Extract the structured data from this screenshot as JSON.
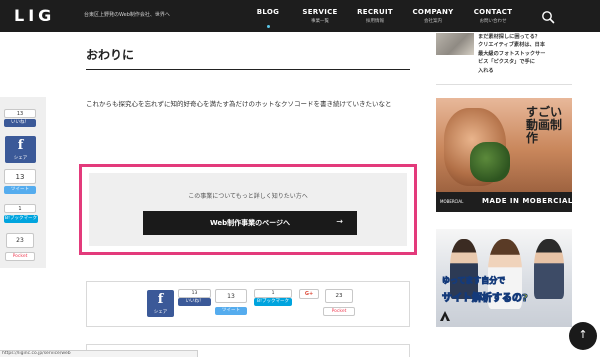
{
  "header": {
    "logo": "LIG",
    "tagline": "台東区上野発のWeb制作会社、世界へ",
    "nav": [
      {
        "en": "BLOG",
        "ja": "",
        "active": true
      },
      {
        "en": "SERVICE",
        "ja": "事業一覧",
        "active": false
      },
      {
        "en": "RECRUIT",
        "ja": "採用情報",
        "active": false
      },
      {
        "en": "COMPANY",
        "ja": "会社案内",
        "active": false
      },
      {
        "en": "CONTACT",
        "ja": "お問い合わせ",
        "active": false
      }
    ],
    "search_icon": "search-icon"
  },
  "article": {
    "section_title": "おわりに",
    "body": "これからも探究心を忘れずに知的好奇心を満たす為だけのホットなクソコードを書き続けていきたいなと"
  },
  "cta": {
    "lead": "この事業についてもっと詳しく知りたい方へ",
    "button_label": "Web制作事業のページへ",
    "arrow": "→"
  },
  "share": {
    "facebook_label": "シェア",
    "like_count": "13",
    "like_label": "いいね！",
    "tweet_count": "13",
    "tweet_label": "ツイート",
    "hatena_count": "1",
    "hatena_label": "B!ブックマーク",
    "gplus_label": "G+",
    "pocket_count": "23",
    "pocket_label": "Pocket"
  },
  "sidebar": {
    "article_lines": [
      "まだ素材探しに困ってる？",
      "クリエイティブ素材は、日本",
      "最大級のフォトストックサー",
      "ビス「ピクスタ」で手に",
      "入れる"
    ],
    "ad1": {
      "copy": "すごい動画制作",
      "small": "MOBERCIAL",
      "made": "MADE IN MOBERCIAL"
    },
    "ad2": {
      "copy_line1": "ゆってます自分で",
      "copy_line2": "サイト解析するの?"
    }
  },
  "to_top": "↑",
  "status_url": "https://liginc.co.jp/service/web"
}
